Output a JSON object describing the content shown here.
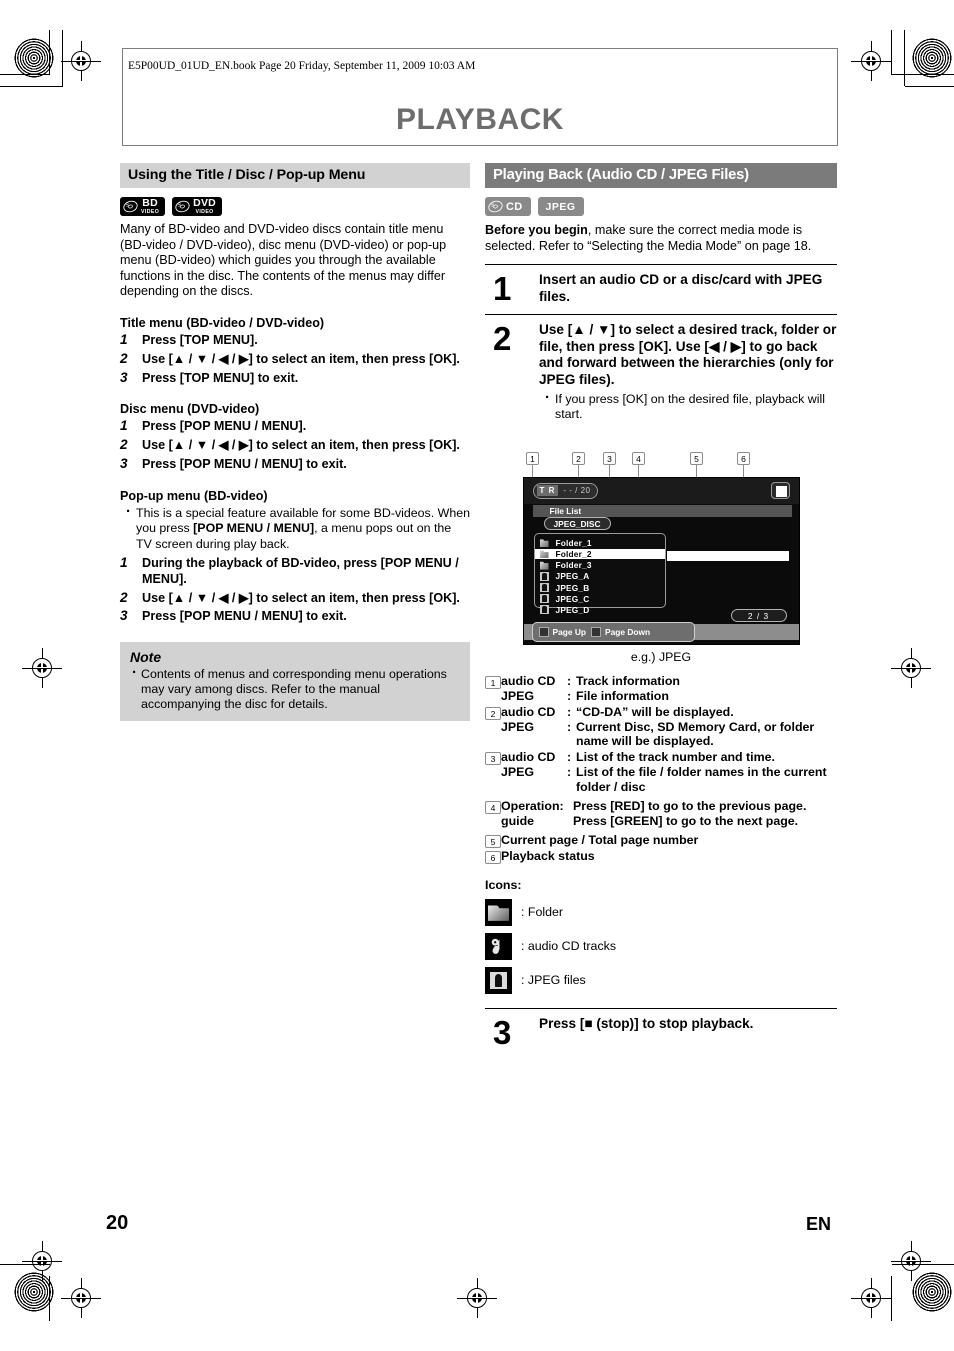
{
  "page": {
    "book_line": "E5P00UD_01UD_EN.book  Page 20  Friday, September 11, 2009  10:03 AM",
    "chapter_title": "PLAYBACK",
    "page_number": "20",
    "language_code": "EN"
  },
  "left_column": {
    "section_title": "Using the Title / Disc / Pop-up Menu",
    "badges": [
      {
        "icon": "disc-icon",
        "main": "BD",
        "sub": "VIDEO"
      },
      {
        "icon": "disc-icon",
        "main": "DVD",
        "sub": "VIDEO"
      }
    ],
    "intro": "Many of BD-video and DVD-video discs contain title menu (BD-video / DVD-video), disc menu (DVD-video) or pop-up menu (BD-video) which guides you through the available functions in the disc. The contents of the menus may differ depending on the discs.",
    "groups": [
      {
        "heading": "Title menu (BD-video / DVD-video)",
        "steps": [
          {
            "n": "1",
            "text": "Press [TOP MENU]."
          },
          {
            "n": "2",
            "text": "Use [▲ / ▼ / ◀ / ▶] to select an item, then press [OK]."
          },
          {
            "n": "3",
            "text": "Press [TOP MENU] to exit."
          }
        ]
      },
      {
        "heading": "Disc menu (DVD-video)",
        "steps": [
          {
            "n": "1",
            "text": "Press [POP MENU / MENU]."
          },
          {
            "n": "2",
            "text": "Use [▲ / ▼ / ◀ / ▶] to select an item, then press [OK]."
          },
          {
            "n": "3",
            "text": "Press [POP MENU / MENU] to exit."
          }
        ]
      }
    ],
    "popup_group": {
      "heading": "Pop-up menu (BD-video)",
      "bullet_a": "This is a special feature available for some BD-videos. When you press ",
      "bullet_b": "[POP MENU / MENU]",
      "bullet_c": ", a menu pops out on the TV screen during play back.",
      "steps": [
        {
          "n": "1",
          "text": "During the playback of BD-video, press [POP MENU / MENU]."
        },
        {
          "n": "2",
          "text": "Use [▲ / ▼ / ◀ / ▶] to select an item, then press [OK]."
        },
        {
          "n": "3",
          "text": "Press [POP MENU / MENU] to exit."
        }
      ]
    },
    "note": {
      "title": "Note",
      "items": [
        "Contents of menus and corresponding menu operations may vary among discs. Refer to the manual accompanying the disc for details."
      ]
    }
  },
  "right_column": {
    "section_title": "Playing Back (Audio CD / JPEG Files)",
    "badges": [
      {
        "icon": "disc-icon",
        "main": "CD"
      },
      {
        "icon": "text-badge",
        "main": "JPEG"
      }
    ],
    "before_bold": "Before you begin",
    "before_rest": ", make sure the correct media mode is selected. Refer to “Selecting the Media Mode” on page 18.",
    "steps": [
      {
        "n": "1",
        "text": "Insert an audio CD or a disc/card with JPEG files.",
        "bullets": []
      },
      {
        "n": "2",
        "text": "Use [▲ / ▼] to select a desired track, folder or file, then press [OK]. Use [◀ / ▶] to go back and forward between the hierarchies (only for JPEG files).",
        "bullets": [
          "If you press [OK] on the desired file, playback will start."
        ]
      }
    ],
    "final_step": {
      "n": "3",
      "text": "Press [■ (stop)] to stop playback."
    },
    "screen": {
      "callouts": [
        "1",
        "2",
        "3",
        "4",
        "5",
        "6"
      ],
      "track_tag": "T R",
      "track_value": "- - / 20",
      "file_list_label": "File List",
      "disc_name": "JPEG_DISC",
      "items": [
        {
          "icon": "folder-icon",
          "name": "Folder_1",
          "selected": false
        },
        {
          "icon": "folder-icon",
          "name": "Folder_2",
          "selected": true
        },
        {
          "icon": "folder-icon",
          "name": "Folder_3",
          "selected": false
        },
        {
          "icon": "jpeg-file-icon",
          "name": "JPEG_A",
          "selected": false
        },
        {
          "icon": "jpeg-file-icon",
          "name": "JPEG_B",
          "selected": false
        },
        {
          "icon": "jpeg-file-icon",
          "name": "JPEG_C",
          "selected": false
        },
        {
          "icon": "jpeg-file-icon",
          "name": "JPEG_D",
          "selected": false
        }
      ],
      "page_indicator": "2 / 3",
      "guide_prev": "Page Up",
      "guide_next": "Page Down",
      "caption": "e.g.) JPEG"
    },
    "legend": [
      {
        "n": "1",
        "rows": [
          {
            "label": "audio CD",
            "colon": ":",
            "value": "Track information"
          },
          {
            "label": "JPEG",
            "colon": ":",
            "value": "File information"
          }
        ]
      },
      {
        "n": "2",
        "rows": [
          {
            "label": "audio CD",
            "colon": ":",
            "value": "“CD-DA” will be displayed."
          },
          {
            "label": "JPEG",
            "colon": ":",
            "value": "Current Disc, SD Memory Card, or folder name will be displayed."
          }
        ]
      },
      {
        "n": "3",
        "rows": [
          {
            "label": "audio CD",
            "colon": ":",
            "value": "List of the track number and time."
          },
          {
            "label": "JPEG",
            "colon": ":",
            "value": "List of the file / folder names in the current folder / disc"
          }
        ]
      },
      {
        "n": "4",
        "rows": [
          {
            "label": "Operation:",
            "colon": "",
            "value": "Press [RED] to go to the previous page."
          },
          {
            "label": "guide",
            "colon": "",
            "value": "Press [GREEN] to go to the next page."
          }
        ]
      },
      {
        "n": "5",
        "single": "Current page / Total page number"
      },
      {
        "n": "6",
        "single": "Playback status"
      }
    ],
    "icons_heading": "Icons:",
    "icon_legend": [
      {
        "icon": "folder-icon",
        "label": ": Folder"
      },
      {
        "icon": "audio-note-icon",
        "label": ": audio CD tracks"
      },
      {
        "icon": "jpeg-file-icon",
        "label": ": JPEG files"
      }
    ]
  }
}
